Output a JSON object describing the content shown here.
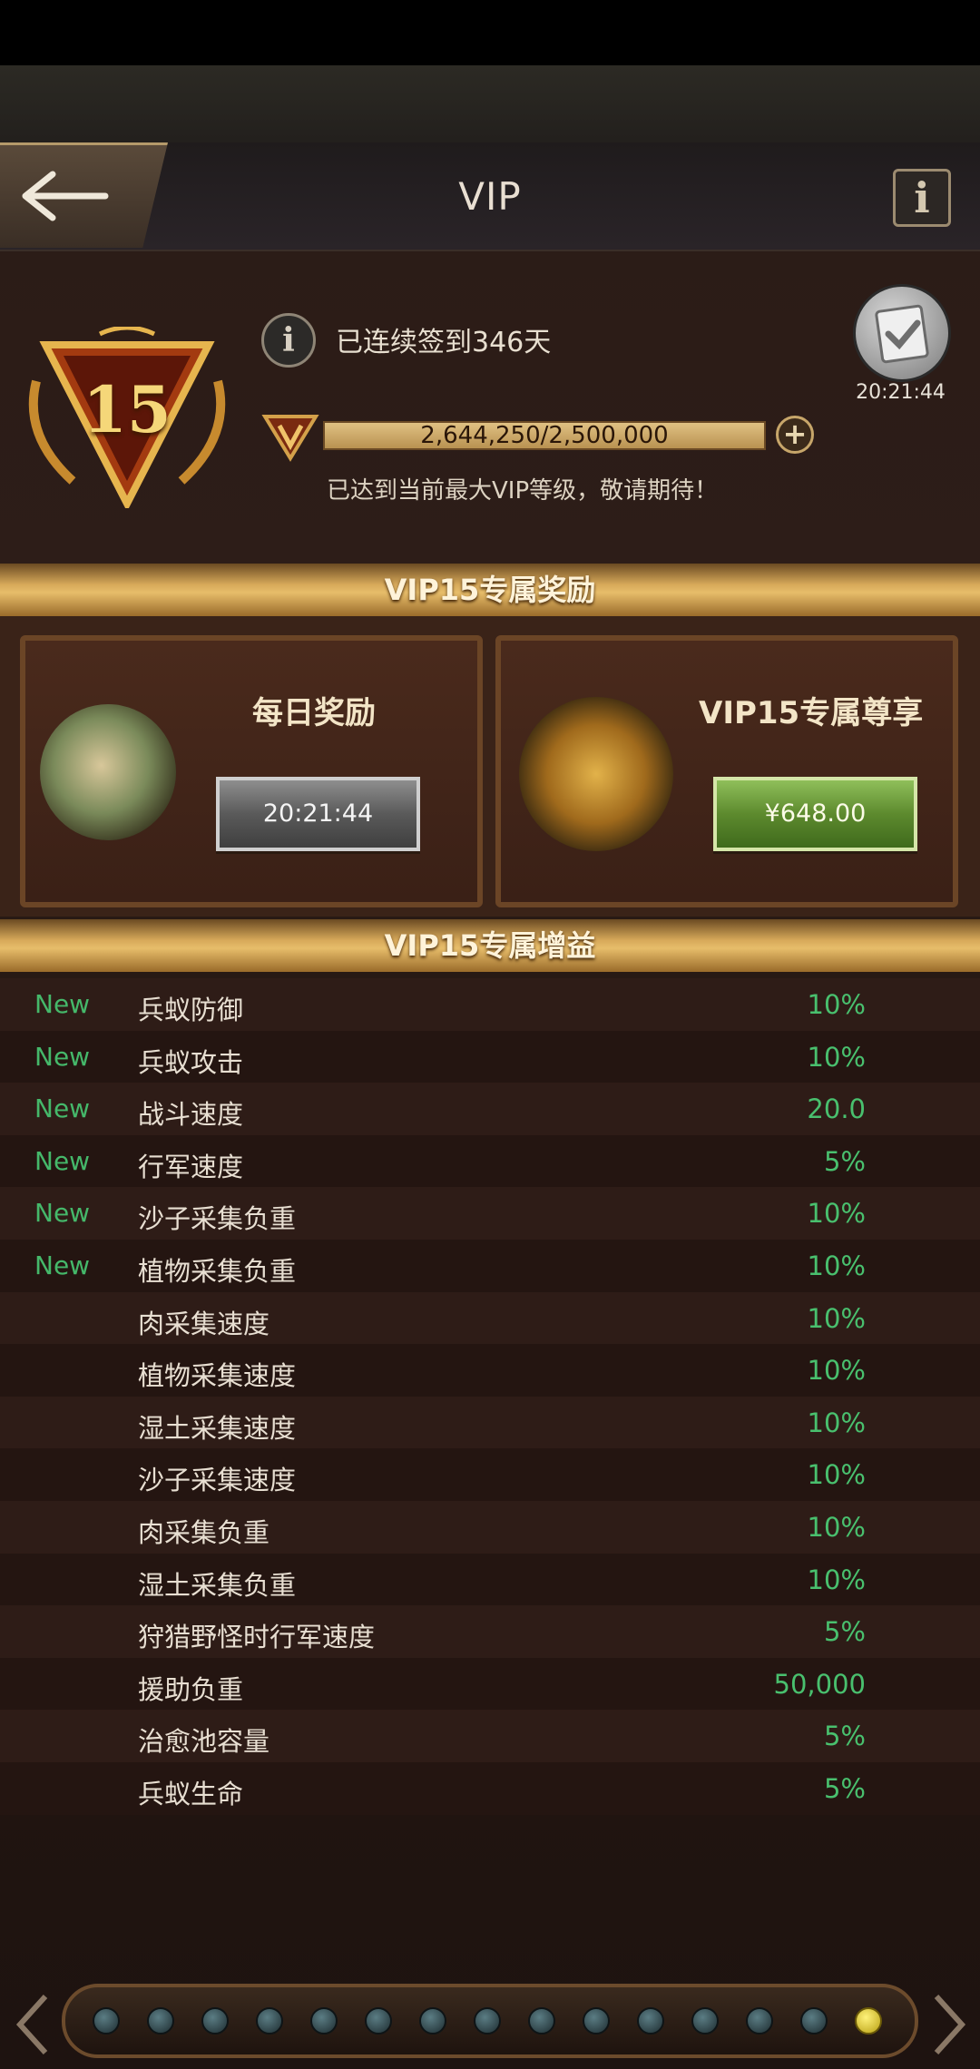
{
  "header": {
    "title": "VIP",
    "info_glyph": "i",
    "back_icon": "back-arrow-icon"
  },
  "vip": {
    "level": "15",
    "signin_text": "已连续签到346天",
    "signin_time": "20:21:44",
    "points_text": "2,644,250/2,500,000",
    "points_current": 2644250,
    "points_max": 2500000,
    "plus_glyph": "+",
    "max_level_text": "已达到当前最大VIP等级，敬请期待！"
  },
  "rewards": {
    "banner": "VIP15专属奖励",
    "daily": {
      "title": "每日奖励",
      "timer": "20:21:44"
    },
    "exclusive": {
      "title": "VIP15专属尊享",
      "price": "¥648.00"
    }
  },
  "buffs": {
    "banner": "VIP15专属增益",
    "rows": [
      {
        "tag": "New",
        "name": "兵蚁防御",
        "value": "10%"
      },
      {
        "tag": "New",
        "name": "兵蚁攻击",
        "value": "10%"
      },
      {
        "tag": "New",
        "name": "战斗速度",
        "value": "20.0"
      },
      {
        "tag": "New",
        "name": "行军速度",
        "value": "5%"
      },
      {
        "tag": "New",
        "name": "沙子采集负重",
        "value": "10%"
      },
      {
        "tag": "New",
        "name": "植物采集负重",
        "value": "10%"
      },
      {
        "tag": "",
        "name": "肉采集速度",
        "value": "10%"
      },
      {
        "tag": "",
        "name": "植物采集速度",
        "value": "10%"
      },
      {
        "tag": "",
        "name": "湿土采集速度",
        "value": "10%"
      },
      {
        "tag": "",
        "name": "沙子采集速度",
        "value": "10%"
      },
      {
        "tag": "",
        "name": "肉采集负重",
        "value": "10%"
      },
      {
        "tag": "",
        "name": "湿土采集负重",
        "value": "10%"
      },
      {
        "tag": "",
        "name": "狩猎野怪时行军速度",
        "value": "5%"
      },
      {
        "tag": "",
        "name": "援助负重",
        "value": "50,000"
      },
      {
        "tag": "",
        "name": "治愈池容量",
        "value": "5%"
      },
      {
        "tag": "",
        "name": "兵蚁生命",
        "value": "5%"
      }
    ]
  },
  "pager": {
    "total": 15,
    "active": 15
  },
  "colors": {
    "accent_gold": "#e7bd6a",
    "value_green": "#49c06e",
    "new_green": "#45b86a"
  }
}
